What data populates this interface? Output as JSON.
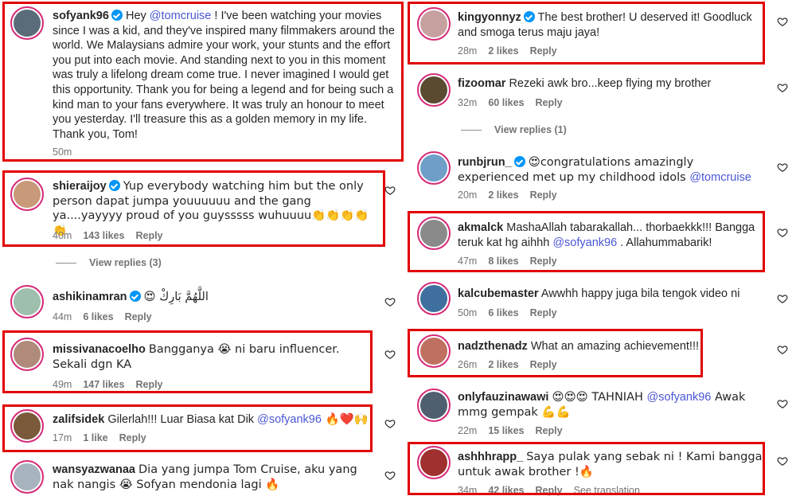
{
  "left": {
    "comments": [
      {
        "username": "sofyank96",
        "verified": true,
        "text_parts": [
          "Hey ",
          "@tomcruise",
          " ! I've been watching your movies since I was a kid, and they've inspired many filmmakers around the world. We Malaysians admire your work, your stunts and the effort you put into each movie. And standing next to you in this moment was truly a lifelong dream come true. I never imagined I would get this opportunity. Thank you for being a legend and for being such a kind man to your fans everywhere. It was truly an honour to meet you yesterday. I'll treasure this as a golden memory in my life. Thank you, Tom!"
        ],
        "time": "50m",
        "likes": "",
        "reply": "",
        "avatar_color": "#5a6b7a"
      },
      {
        "username": "shieraijoy",
        "verified": true,
        "text_parts": [
          "Yup everybody watching him but the only person dapat jumpa youuuuuu and the gang ya....yayyyy proud of you guysssss wuhuuuu👏👏👏👏👏"
        ],
        "time": "40m",
        "likes": "143 likes",
        "reply": "Reply",
        "avatar_color": "#c89a7a"
      },
      {
        "username": "ashikinamran",
        "verified": true,
        "text_parts": [
          "😍 اللَّهُمَّ بَارِكْ"
        ],
        "time": "44m",
        "likes": "6 likes",
        "reply": "Reply",
        "avatar_color": "#9fbfae"
      },
      {
        "username": "missivanacoelho",
        "verified": false,
        "text_parts": [
          "Bangganya 😭 ni baru influencer. Sekali dgn KA"
        ],
        "time": "49m",
        "likes": "147 likes",
        "reply": "Reply",
        "avatar_color": "#b08b7c"
      },
      {
        "username": "zalifsidek",
        "verified": false,
        "text_parts": [
          "Gilerlah!!! Luar Biasa kat Dik ",
          "@sofyank96",
          " 🔥❤️🙌"
        ],
        "time": "17m",
        "likes": "1 like",
        "reply": "Reply",
        "avatar_color": "#7a5a3a"
      },
      {
        "username": "wansyazwanaa",
        "verified": false,
        "text_parts": [
          "Dia yang jumpa Tom Cruise, aku yang nak nangis 😭 Sofyan mendonia lagi 🔥"
        ],
        "time": "",
        "likes": "",
        "reply": "",
        "avatar_color": "#a7b3bf"
      }
    ],
    "view_replies": "View replies (3)"
  },
  "right": {
    "comments": [
      {
        "username": "kingyonnyz",
        "verified": true,
        "text_parts": [
          "The best brother! U deserved it! Goodluck and smoga terus maju jaya!"
        ],
        "time": "28m",
        "likes": "2 likes",
        "reply": "Reply",
        "avatar_color": "#c7a0a0"
      },
      {
        "username": "fizoomar",
        "verified": false,
        "text_parts": [
          "Rezeki awk bro...keep flying my brother"
        ],
        "time": "32m",
        "likes": "60 likes",
        "reply": "Reply",
        "avatar_color": "#5a4a30"
      },
      {
        "username": "runbjrun_",
        "verified": true,
        "text_parts": [
          "😍congratulations amazingly experienced met up my childhood idols ",
          "@tomcruise"
        ],
        "time": "20m",
        "likes": "2 likes",
        "reply": "Reply",
        "avatar_color": "#6f9fc8"
      },
      {
        "username": "akmalck",
        "verified": false,
        "text_parts": [
          "MashaAllah tabarakallah... thorbaekkk!!! Bangga teruk kat hg aihhh ",
          "@sofyank96",
          " . Allahummabarik!"
        ],
        "time": "47m",
        "likes": "8 likes",
        "reply": "Reply",
        "avatar_color": "#8a8a8a"
      },
      {
        "username": "kalcubemaster",
        "verified": false,
        "text_parts": [
          "Awwhh happy juga bila tengok video ni"
        ],
        "time": "50m",
        "likes": "6 likes",
        "reply": "Reply",
        "avatar_color": "#3f6f9f"
      },
      {
        "username": "nadzthenadz",
        "verified": false,
        "text_parts": [
          "What an amazing achievement!!!"
        ],
        "time": "26m",
        "likes": "2 likes",
        "reply": "Reply",
        "avatar_color": "#c07060"
      },
      {
        "username": "onlyfauzinawawi",
        "verified": false,
        "text_parts": [
          "😍😍😍 TAHNIAH ",
          "@sofyank96",
          " Awak mmg gempak 💪💪"
        ],
        "time": "22m",
        "likes": "15 likes",
        "reply": "Reply",
        "avatar_color": "#4f5f6f"
      },
      {
        "username": "ashhhrapp_",
        "verified": false,
        "text_parts": [
          "Saya pulak yang sebak ni ! Kami bangga untuk awak brother !🔥"
        ],
        "time": "34m",
        "likes": "42 likes",
        "reply": "Reply",
        "see_translation": "See translation",
        "avatar_color": "#a03030"
      }
    ],
    "view_replies": "View replies (1)"
  },
  "colors": {
    "highlight": "#e10000",
    "mention": "#4a56d6",
    "verified": "#0095f6",
    "meta": "#737373"
  }
}
